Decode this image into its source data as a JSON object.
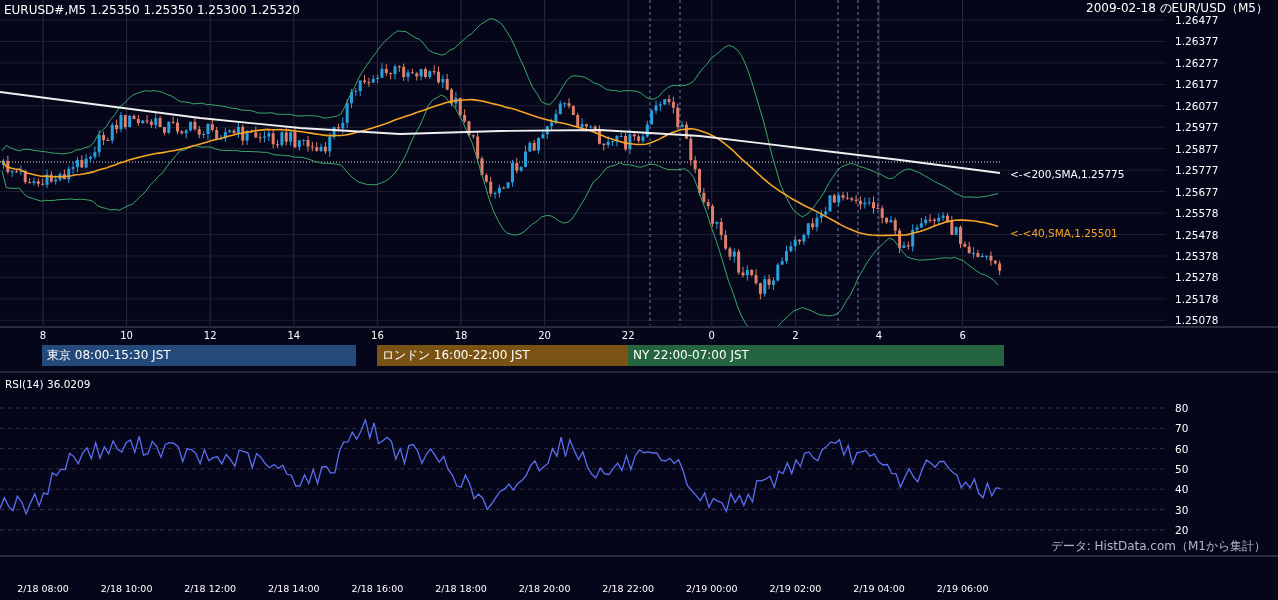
{
  "header": {
    "symbol_quote": "EURUSD#,M5 1.25350 1.25350 1.25300 1.25320",
    "title": "2009-02-18 のEUR/USD（M5）"
  },
  "price_axis": [
    "1.26477",
    "1.26377",
    "1.26277",
    "1.26177",
    "1.26077",
    "1.25977",
    "1.25877",
    "1.25777",
    "1.25677",
    "1.25578",
    "1.25478",
    "1.25378",
    "1.25278",
    "1.25178",
    "1.25078"
  ],
  "indicator_labels": [
    {
      "text": "<-<200,SMA,1.25775",
      "color": "#ffffff"
    },
    {
      "text": "<-<40,SMA,1.25501",
      "color": "#f5a623"
    }
  ],
  "hour_axis": [
    "8",
    "10",
    "12",
    "14",
    "16",
    "18",
    "20",
    "22",
    "0",
    "2",
    "4",
    "6"
  ],
  "sessions": [
    {
      "label": "東京 08:00-15:30 JST",
      "color": "#234a7a"
    },
    {
      "label": "ロンドン 16:00-22:00 JST",
      "color": "#7a5214"
    },
    {
      "label": "NY 22:00-07:00 JST",
      "color": "#246540"
    }
  ],
  "rsi": {
    "title": "RSI(14) 36.0209",
    "axis": [
      "80",
      "70",
      "60",
      "50",
      "40",
      "30",
      "20"
    ]
  },
  "credit": "データ: HistData.com（M1から集計）",
  "time_axis": [
    "2/18 08:00",
    "2/18 10:00",
    "2/18 12:00",
    "2/18 14:00",
    "2/18 16:00",
    "2/18 18:00",
    "2/18 20:00",
    "2/18 22:00",
    "2/19 00:00",
    "2/19 02:00",
    "2/19 04:00",
    "2/19 06:00"
  ]
}
